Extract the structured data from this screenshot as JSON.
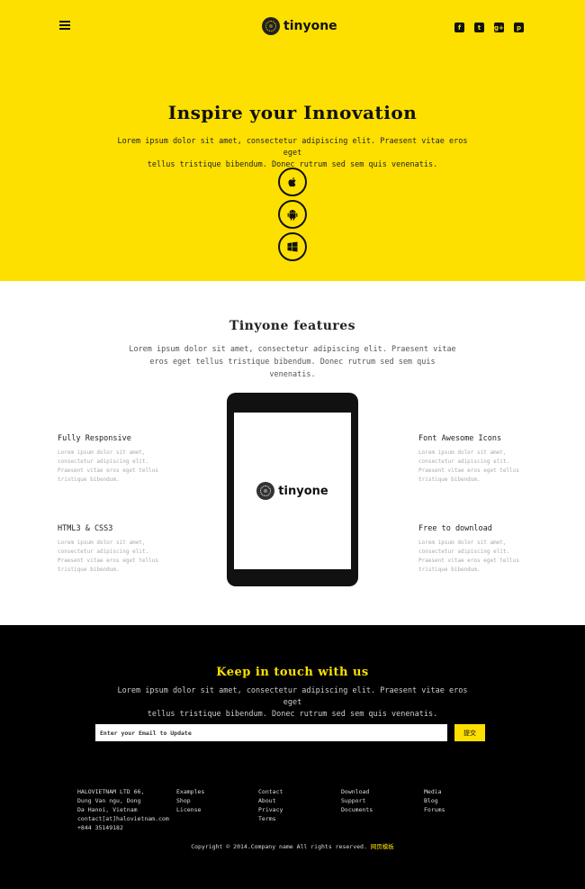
{
  "header": {
    "brand": "tinyone",
    "social": [
      "f",
      "t",
      "g+",
      "p"
    ],
    "social_icons": [
      "facebook-icon",
      "twitter-icon",
      "google-plus-icon",
      "pinterest-icon"
    ]
  },
  "hero": {
    "title": "Inspire your Innovation",
    "desc_line1": "Lorem ipsum dolor sit amet, consectetur adipiscing elit. Praesent vitae eros eget",
    "desc_line2": "tellus tristique bibendum. Donec rutrum sed sem quis venenatis.",
    "platforms": [
      "apple-icon",
      "android-icon",
      "windows-icon"
    ]
  },
  "features": {
    "title": "Tinyone features",
    "desc_line1": "Lorem ipsum dolor sit amet, consectetur adipiscing elit. Praesent vitae",
    "desc_line2": "eros eget tellus tristique bibendum. Donec rutrum sed sem quis venenatis.",
    "items": [
      {
        "title": "Fully Responsive",
        "text": "Lorem ipsum dolor sit amet, consectetur adipiscing elit. Praesent vitae eros eget tellus tristique bibendum."
      },
      {
        "title": "Font Awesome Icons",
        "text": "Lorem ipsum dolor sit amet, consectetur adipiscing elit. Praesent vitae eros eget tellus tristique bibendum."
      },
      {
        "title": "HTML3 & CSS3",
        "text": "Lorem ipsum dolor sit amet, consectetur adipiscing elit. Praesent vitae eros eget tellus tristique bibendum."
      },
      {
        "title": "Free to download",
        "text": "Lorem ipsum dolor sit amet, consectetur adipiscing elit. Praesent vitae eros eget tellus tristique bibendum."
      }
    ],
    "device_brand": "tinyone"
  },
  "contact": {
    "title": "Keep in touch with us",
    "desc_line1": "Lorem ipsum dolor sit amet, consectetur adipiscing elit. Praesent vitae eros eget",
    "desc_line2": "tellus tristique bibendum. Donec rutrum sed sem quis venenatis.",
    "email_placeholder": "Enter your Email to Update",
    "submit_label": "提交"
  },
  "footer": {
    "address": [
      "HALOVIETNAM LTD 66,",
      "Dung Van ngu, Dong",
      "Da Hanoi, Vietnam",
      "contact[at]halovietnam.com",
      "+844 35149182"
    ],
    "col1": [
      "Examples",
      "Shop",
      "License"
    ],
    "col2": [
      "Contact",
      "About",
      "Privacy",
      "Terms"
    ],
    "col3": [
      "Download",
      "Support",
      "Documents"
    ],
    "col4": [
      "Media",
      "Blog",
      "Forums"
    ],
    "copyright": "Copyright © 2014.Company name All rights reserved.",
    "copyright_link": "网页模板"
  },
  "colors": {
    "accent": "#fde000",
    "dark": "#000000"
  }
}
